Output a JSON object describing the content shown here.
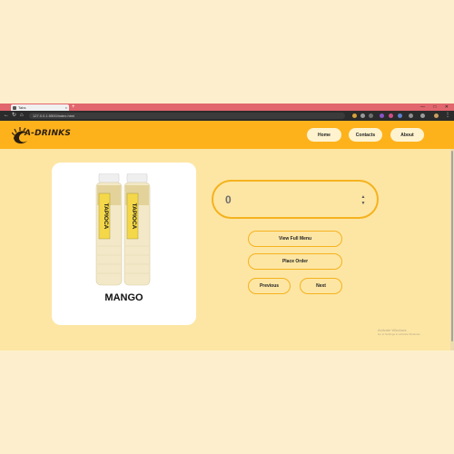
{
  "browser": {
    "tab_title": "Tabs",
    "url": "127.0.0.1:5500/index.html",
    "new_tab_symbol": "+",
    "tab_close_symbol": "×",
    "window_controls": "—  □  ✕"
  },
  "header": {
    "logo_text": "A-DRINKS",
    "nav": [
      "Home",
      "Contacts",
      "About"
    ]
  },
  "product": {
    "name": "MANGO",
    "label_text": "TAPIOCA"
  },
  "quantity": {
    "value": "0"
  },
  "actions": {
    "view_menu": "View Full Menu",
    "place_order": "Place Order",
    "previous": "Previous",
    "next": "Next"
  },
  "watermark": {
    "title": "Activate Windows",
    "subtitle": "Go to Settings to activate Windows."
  },
  "colors": {
    "page_bg": "#fde6a4",
    "header_bg": "#fdb21c",
    "accent_border": "#f5b21e",
    "nav_button_bg": "#fff3cf"
  }
}
